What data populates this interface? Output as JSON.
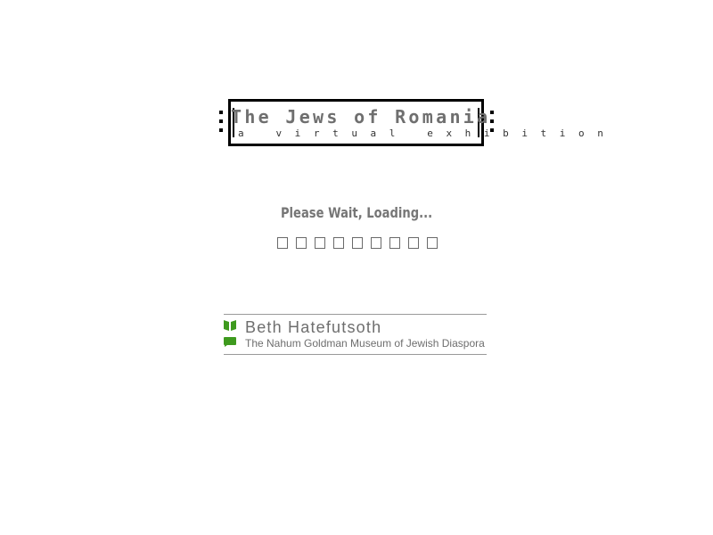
{
  "exhibition": {
    "title": "The Jews of Romania",
    "subtitle": "a virtual exhibition"
  },
  "loading": {
    "message": "Please Wait, Loading...",
    "segments_total": 9,
    "segments_filled": 0
  },
  "museum": {
    "name": "Beth Hatefutsoth",
    "full_name": "The Nahum Goldman Museum of Jewish Diaspora",
    "icons": [
      "book-icon",
      "speech-bubble-icon"
    ],
    "accent_color": "#3e9a1e"
  },
  "colors": {
    "background": "#ffffff",
    "text_gray": "#6f6f6f",
    "frame": "#000000"
  }
}
